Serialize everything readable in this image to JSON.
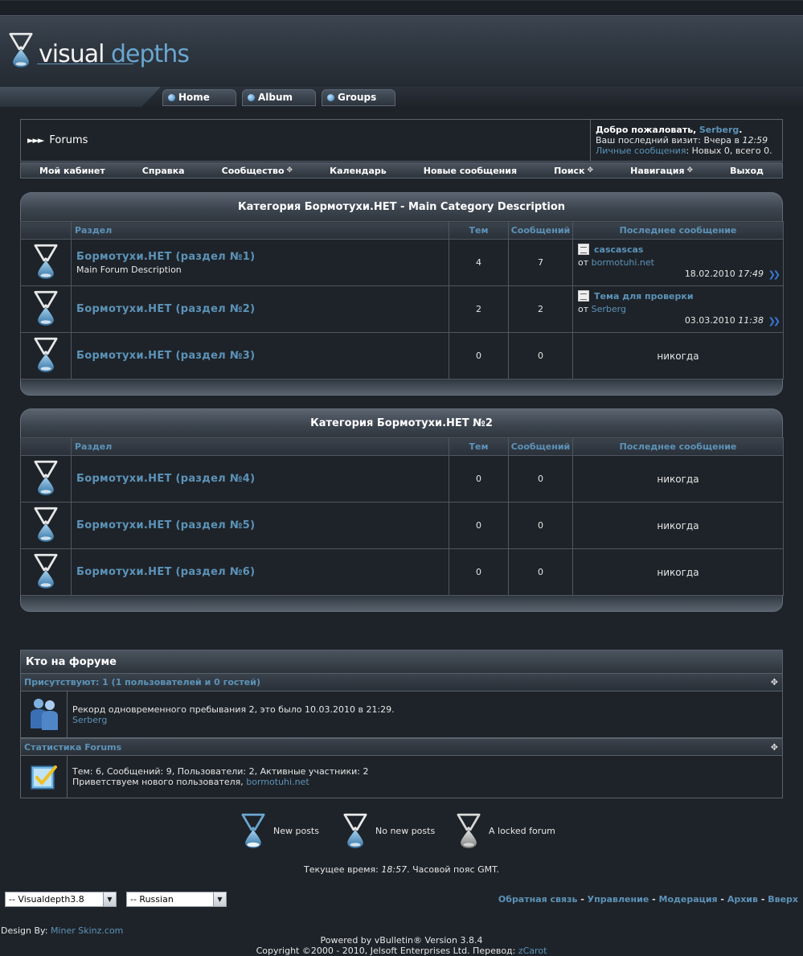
{
  "header": {
    "logo_word1": "visual",
    "logo_word2": "depths",
    "tabs": [
      "Home",
      "Album",
      "Groups"
    ]
  },
  "breadcrumb": {
    "title": "Forums"
  },
  "welcome": {
    "greeting": "Добро пожаловать,",
    "username": "Serberg",
    "period": ".",
    "last_visit_label": "Ваш последний визит: Вчера в",
    "last_visit_time": "12:59",
    "pm_link": "Личные сообщения",
    "pm_stats": ": Новых 0, всего 0."
  },
  "navbar": {
    "items": [
      "Мой кабинет",
      "Справка",
      "Сообщество",
      "Календарь",
      "Новые сообщения",
      "Поиск",
      "Навигация",
      "Выход"
    ]
  },
  "columns": {
    "forum": "Раздел",
    "threads": "Тем",
    "posts": "Сообщений",
    "last_post": "Последнее сообщение"
  },
  "categories": [
    {
      "title": "Категория Бормотухи.НЕТ - Main Category Description",
      "forums": [
        {
          "title": "Бормотухи.НЕТ (раздел №1)",
          "description": "Main Forum Description",
          "threads": "4",
          "posts": "7",
          "last_title": "cascascas",
          "last_by_prefix": "от",
          "last_by": "bormotuhi.net",
          "last_date": "18.02.2010",
          "last_time": "17:49"
        },
        {
          "title": "Бормотухи.НЕТ (раздел №2)",
          "threads": "2",
          "posts": "2",
          "last_title": "Тема для проверки",
          "last_by_prefix": "от",
          "last_by": "Serberg",
          "last_date": "03.03.2010",
          "last_time": "11:38"
        },
        {
          "title": "Бормотухи.НЕТ (раздел №3)",
          "threads": "0",
          "posts": "0",
          "never": "никогда"
        }
      ]
    },
    {
      "title": "Категория Бормотухи.НЕТ №2",
      "forums": [
        {
          "title": "Бормотухи.НЕТ (раздел №4)",
          "threads": "0",
          "posts": "0",
          "never": "никогда"
        },
        {
          "title": "Бормотухи.НЕТ (раздел №5)",
          "threads": "0",
          "posts": "0",
          "never": "никогда"
        },
        {
          "title": "Бормотухи.НЕТ (раздел №6)",
          "threads": "0",
          "posts": "0",
          "never": "никогда"
        }
      ]
    }
  ],
  "whos_online": {
    "title": "Кто на форуме",
    "online_header": "Присутствуют: 1 (1 пользователей и 0 гостей)",
    "record_text": "Рекорд одновременного пребывания 2, это было 10.03.2010 в 21:29.",
    "online_user": "Serberg",
    "stats_header": "Статистика Forums",
    "stats_text": "Тем: 6, Сообщений: 9, Пользователи: 2, Активные участники: 2",
    "welcome_text": "Приветствуем нового пользователя,",
    "new_user": "bormotuhi.net"
  },
  "legend": {
    "new_posts": "New posts",
    "no_new_posts": "No new posts",
    "locked": "A locked forum"
  },
  "time": {
    "label": "Текущее время:",
    "value": "18:57",
    "tz": ". Часовой пояс GMT."
  },
  "footer": {
    "style_select": "-- Visualdepth3.8",
    "lang_select": "-- Russian",
    "links": [
      "Обратная связь",
      "Управление",
      "Модерация",
      "Архив",
      "Вверх"
    ],
    "separator": " - ",
    "design_label": "Design By:",
    "design_link": "Miner Skinz.com",
    "powered": "Powered by vBulletin® Version 3.8.4",
    "copyright": "Copyright ©2000 - 2010, Jelsoft Enterprises Ltd. Перевод:",
    "translator": "zCarot"
  },
  "colors": {
    "background": "#1e2329",
    "link": "#5c93b8",
    "border": "#5a626c"
  }
}
